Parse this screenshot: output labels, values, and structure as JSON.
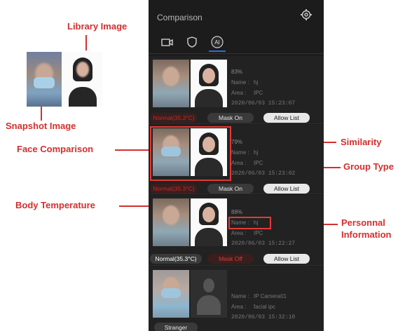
{
  "colors": {
    "panel_bg": "#1c1c1c",
    "annotation_red": "#d32f2f",
    "alert_red": "#e0392b",
    "active_tab": "#2d6cdf"
  },
  "annotations": {
    "library_image": "Library Image",
    "snapshot_image": "Snapshot Image",
    "face_comparison": "Face Comparison",
    "similarity": "Similarity",
    "group_type": "Group Type",
    "body_temperature": "Body Temperature",
    "personnal_information_1": "Personnal",
    "personnal_information_2": "Information"
  },
  "panel": {
    "title": "Comparison",
    "settings_icon": "gear-icon",
    "tabs": [
      {
        "icon": "video-camera-icon",
        "active": false
      },
      {
        "icon": "shield-icon",
        "active": false
      },
      {
        "label": "AI",
        "icon": "ai-icon",
        "active": true
      }
    ]
  },
  "records": [
    {
      "similarity": "83%",
      "name_key": "Name :",
      "name_value": "hj",
      "area_key": "Area :",
      "area_value": "IPC",
      "timestamp": "2020/06/03 15:23:07",
      "tags": [
        "Normal(35.3°C)",
        "Mask On",
        "Allow List"
      ]
    },
    {
      "similarity": "79%",
      "name_key": "Name :",
      "name_value": "hj",
      "area_key": "Area :",
      "area_value": "IPC",
      "timestamp": "2020/06/03 15:23:02",
      "tags": [
        "Normal(35.3°C)",
        "Mask On",
        "Allow List"
      ]
    },
    {
      "similarity": "88%",
      "name_key": "Name :",
      "name_value": "hj",
      "area_key": "Area :",
      "area_value": "IPC",
      "timestamp": "2020/06/03 15:22:27",
      "tags": [
        "Normal(35.3°C)",
        "Mask Off",
        "Allow List"
      ]
    },
    {
      "similarity": "",
      "name_key": "Name :",
      "name_value": "IP Camera01",
      "area_key": "Area :",
      "area_value": "facial ipc",
      "timestamp": "2020/06/03 15:32:10",
      "tags": [
        "Stranger"
      ]
    }
  ]
}
